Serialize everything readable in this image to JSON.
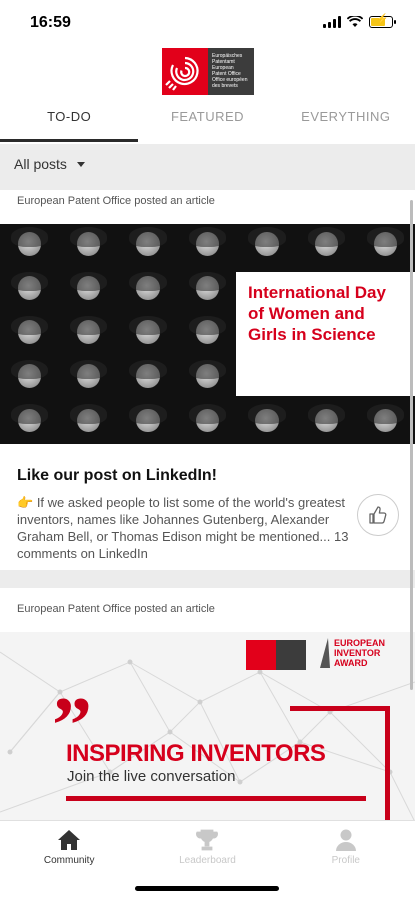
{
  "status_bar": {
    "time": "16:59"
  },
  "header": {
    "logo_lines": [
      "Europäisches",
      "Patentamt",
      "European",
      "Patent Office",
      "Office européen",
      "des brevets"
    ],
    "tabs": [
      {
        "label": "TO-DO",
        "active": true
      },
      {
        "label": "FEATURED",
        "active": false
      },
      {
        "label": "EVERYTHING",
        "active": false
      }
    ]
  },
  "filter": {
    "label": "All posts"
  },
  "posts": [
    {
      "poster": "European Patent Office posted an article",
      "image_lines": [
        "International Day",
        "of Women and",
        "Girls in Science"
      ],
      "title": "Like our post on LinkedIn!",
      "excerpt_icon": "👉",
      "excerpt": "If we asked people to list some of the world's greatest inventors, names like Johannes Gutenberg, Alexander Graham Bell, or Thomas Edison might be mentioned... 13 comments on LinkedIn"
    },
    {
      "poster": "European Patent Office posted an article",
      "award_lines": [
        "EUROPEAN",
        "INVENTOR",
        "AWARD"
      ],
      "quote_mark": "”",
      "headline": "INSPIRING INVENTORS",
      "subheadline": "Join the live conversation"
    }
  ],
  "bottom_nav": [
    {
      "label": "Community",
      "icon": "home-icon",
      "active": true
    },
    {
      "label": "Leaderboard",
      "icon": "trophy-icon",
      "active": false
    },
    {
      "label": "Profile",
      "icon": "person-icon",
      "active": false
    }
  ],
  "colors": {
    "accent": "#d6001c",
    "epo_red": "#e2001a",
    "epo_dark": "#3c3c3c"
  }
}
